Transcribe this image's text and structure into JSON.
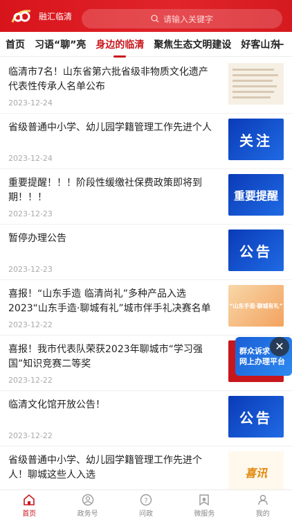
{
  "header": {
    "app_name": "融汇临清",
    "search_placeholder": "请输入关键字"
  },
  "tabs": [
    {
      "label": "首页",
      "active": false
    },
    {
      "label": "习语“聊”亮",
      "active": false
    },
    {
      "label": "身边的临清",
      "active": true
    },
    {
      "label": "聚焦生态文明建设",
      "active": false
    },
    {
      "label": "好客山东",
      "active": false
    }
  ],
  "articles": [
    {
      "title": "临清市7名！山东省第六批省级非物质文化遗产代表性传承人名单公布",
      "date": "2023-12-24",
      "thumb": "doc-icon"
    },
    {
      "title": "省级普通中小学、幼儿园学籍管理工作先进个人",
      "date": "2023-12-24",
      "thumb": "blue-banner",
      "thumb_text": "关注"
    },
    {
      "title": "重要提醒！！！阶段性缓缴社保费政策即将到期！！！",
      "date": "2023-12-23",
      "thumb": "blue-banner",
      "thumb_text": "重要提醒"
    },
    {
      "title": "暂停办理公告",
      "date": "2023-12-23",
      "thumb": "blue-banner",
      "thumb_text": "公告"
    },
    {
      "title": "喜报！“山东手造 临清尚礼”多种产品入选2023“山东手造·聊城有礼”城市伴手礼决赛名单",
      "date": "2023-12-22",
      "thumb": "orange-banner",
      "thumb_text": "“山东手造·聊城有礼”"
    },
    {
      "title": "喜报！我市代表队荣获2023年聊城市“学习强国”知识竞赛二等奖",
      "date": "2023-12-22",
      "thumb": "red-banner"
    },
    {
      "title": "临清文化馆开放公告！",
      "date": "2023-12-22",
      "thumb": "blue-banner",
      "thumb_text": "公告"
    },
    {
      "title": "省级普通中小学、幼儿园学籍管理工作先进个人！聊城这些人入选",
      "date": "",
      "thumb": "gold-banner",
      "thumb_text": "喜讯"
    }
  ],
  "float_badge": {
    "line1": "群众诉求",
    "line2": "网上办理平台"
  },
  "bottom_nav": [
    {
      "label": "首页",
      "icon": "home-icon",
      "active": true
    },
    {
      "label": "政务号",
      "icon": "gov-icon",
      "active": false
    },
    {
      "label": "问政",
      "icon": "question-icon",
      "active": false
    },
    {
      "label": "微服务",
      "icon": "star-icon",
      "active": false
    },
    {
      "label": "我的",
      "icon": "user-icon",
      "active": false
    }
  ],
  "colors": {
    "brand_red": "#c8161d",
    "banner_blue": "#1a4fd0"
  }
}
